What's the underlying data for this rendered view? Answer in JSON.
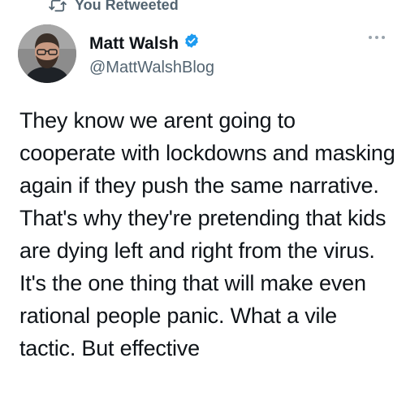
{
  "retweet": {
    "label": "You Retweeted",
    "icon": "retweet-icon"
  },
  "author": {
    "name": "Matt Walsh",
    "handle": "@MattWalshBlog",
    "verified_icon": "verified-badge-icon",
    "verified_color": "#1d9bf0"
  },
  "more_icon": "more-options-icon",
  "tweet": {
    "text": "They know we arent going to cooperate with lockdowns and masking again if they push the same narrative. That's why they're pretending that kids are dying left and right from the virus. It's the one thing that will make even rational people panic. What a vile tactic. But effective"
  },
  "colors": {
    "text": "#0f1419",
    "secondary": "#536471"
  }
}
